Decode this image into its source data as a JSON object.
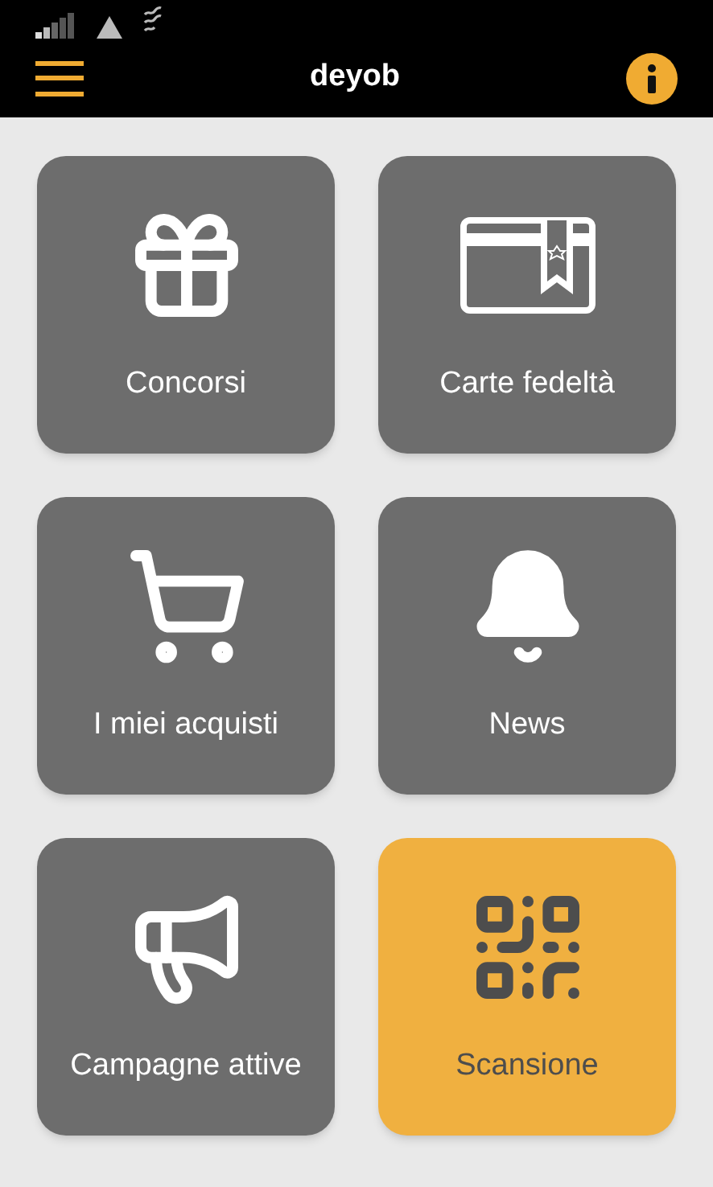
{
  "header": {
    "title": "deyob"
  },
  "tiles": [
    {
      "kind": "gift",
      "label": "Concorsi",
      "selected": false
    },
    {
      "kind": "card",
      "label": "Carte fedeltà",
      "selected": false
    },
    {
      "kind": "cart",
      "label": "I miei acquisti",
      "selected": false
    },
    {
      "kind": "bell",
      "label": "News",
      "selected": false
    },
    {
      "kind": "megaphone",
      "label": "Campagne attive",
      "selected": false
    },
    {
      "kind": "qr",
      "label": "Scansione",
      "selected": true
    }
  ]
}
